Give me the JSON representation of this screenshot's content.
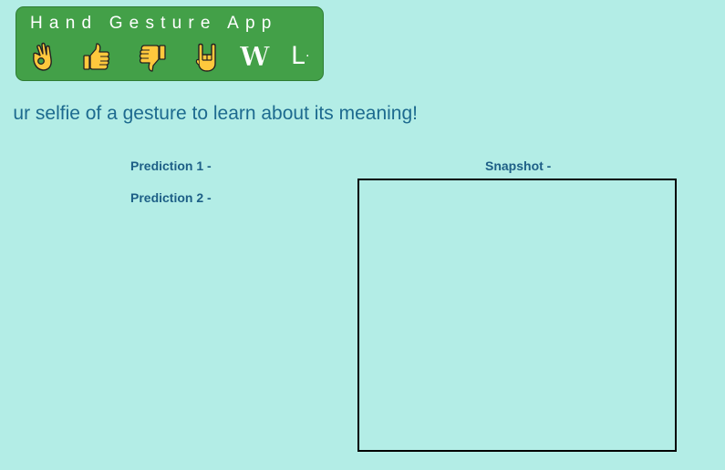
{
  "app": {
    "title": "Hand Gesture App",
    "gesture_icons": [
      "ok-hand-icon",
      "thumbs-up-icon",
      "thumbs-down-icon",
      "rock-on-icon"
    ],
    "letter_w": "W",
    "letter_l": "L",
    "letter_l_dot": "·"
  },
  "instruction": "ur selfie of a gesture to learn about its meaning!",
  "predictions": {
    "p1_label": "Prediction 1 -",
    "p2_label": "Prediction 2 -"
  },
  "snapshot": {
    "label": "Snapshot -"
  },
  "colors": {
    "background": "#b3ede6",
    "card": "#43a048",
    "text_accent": "#1d6a8f",
    "emoji_fill": "#ffc83d"
  }
}
